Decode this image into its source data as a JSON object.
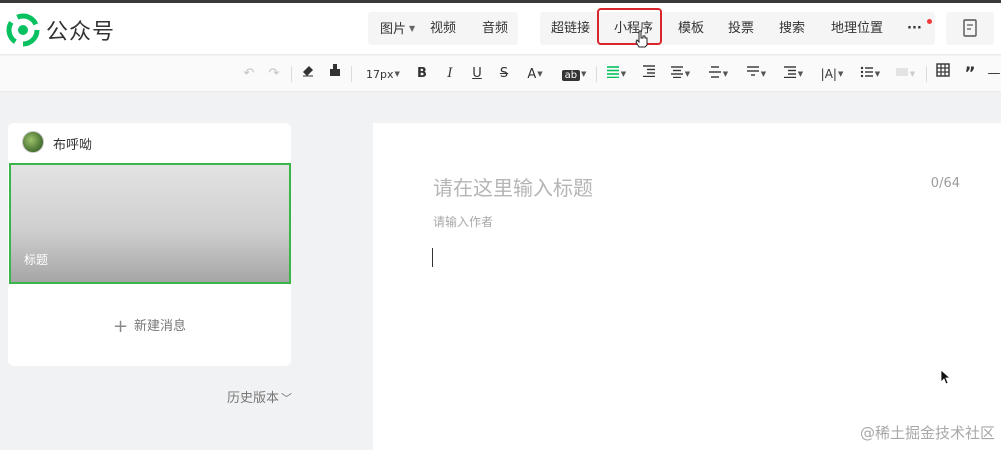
{
  "app": {
    "name": "公众号"
  },
  "header": {
    "media_group": {
      "image": "图片",
      "video": "视频",
      "audio": "音频"
    },
    "insert_group": {
      "hyperlink": "超链接",
      "mini_program": "小程序",
      "template": "模板",
      "vote": "投票",
      "search": "搜索",
      "location": "地理位置",
      "more": "···"
    },
    "highlight_color": "#d9262c",
    "preview_icon": "document-preview-icon"
  },
  "format_toolbar": {
    "font_size": "17px",
    "bold": "B",
    "italic": "I",
    "underline": "U",
    "strike": "S",
    "font_color": "A",
    "bg_color": "ab",
    "icons": [
      "undo-icon",
      "redo-icon",
      "clear-format-icon",
      "format-painter-icon",
      "align-left-icon",
      "indent-icon",
      "align-center-icon",
      "line-height-icon",
      "paragraph-spacing-icon",
      "list-indent-icon",
      "letter-spacing-icon",
      "bullet-list-icon",
      "table-icon",
      "quote-icon",
      "divider-icon"
    ],
    "accent": "#07c160"
  },
  "sidebar": {
    "account_name": "布呼呦",
    "cover_title": "标题",
    "new_message": "新建消息",
    "history": "历史版本",
    "selected_border": "#3bb54a"
  },
  "editor": {
    "title_placeholder": "请在这里输入标题",
    "title_counter": "0/64",
    "author_placeholder": "请输入作者"
  },
  "watermark": "@稀土掘金技术社区"
}
